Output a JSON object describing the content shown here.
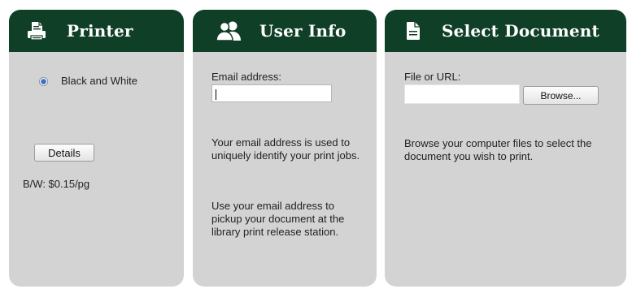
{
  "colors": {
    "header_bg": "#0f3f26",
    "panel_bg": "#d3d3d3",
    "header_text": "#ffffff"
  },
  "panels": [
    {
      "id": "printer",
      "title": "Printer",
      "icon": "printer-icon",
      "radio_label": "Black and White",
      "details_button": "Details",
      "price": "B/W: $0.15/pg"
    },
    {
      "id": "user-info",
      "title": "User Info",
      "icon": "users-icon",
      "email_label": "Email address:",
      "email_value": "",
      "info_1": "Your email address is used to uniquely identify your print jobs.",
      "info_2": "Use your email address to pickup your document at the library print release station."
    },
    {
      "id": "select-document",
      "title": "Select Document",
      "icon": "document-icon",
      "file_label": "File or URL:",
      "file_value": "",
      "browse_button": "Browse...",
      "info": "Browse your computer files to select the document you wish to print."
    }
  ]
}
